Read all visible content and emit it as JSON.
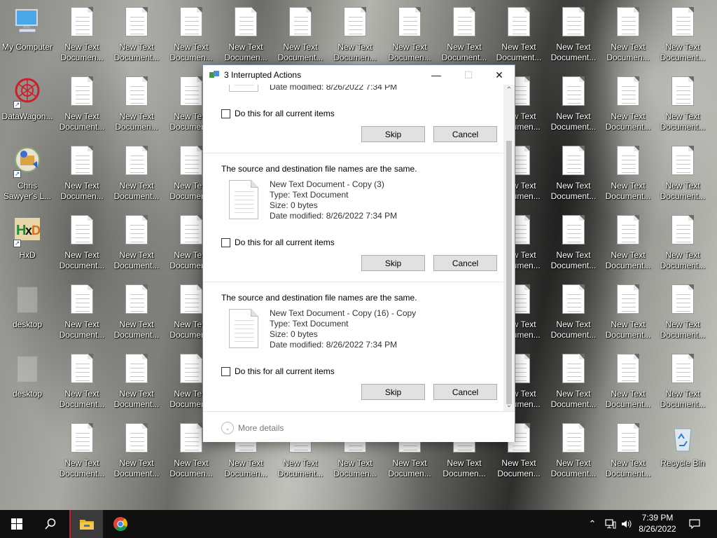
{
  "desktop": {
    "left_icons": [
      {
        "label": "My Computer",
        "icon": "monitor-icon"
      },
      {
        "label": "DataWagon...",
        "icon": "datawagon-icon"
      },
      {
        "label": "Chris\nSawyer's L...",
        "icon": "game-icon"
      },
      {
        "label": "HxD",
        "icon": "hxd-icon"
      },
      {
        "label": "desktop",
        "icon": "blank-file-icon"
      },
      {
        "label": "desktop",
        "icon": "blank-file-icon"
      }
    ],
    "file_labels": {
      "a": "New Text\nDocumen...",
      "b": "New Text\nDocument..."
    },
    "recycle_bin": "Recycle Bin"
  },
  "dialog": {
    "title": "3 Interrupted Actions",
    "controls": {
      "minimize": "—",
      "maximize": "☐",
      "close": "✕"
    },
    "partial_item": {
      "date": "Date modified: 8/26/2022 7:34 PM"
    },
    "items": [
      {
        "message": "The source and destination file names are the same.",
        "name": "New Text Document - Copy (3)",
        "type": "Type: Text Document",
        "size": "Size: 0 bytes",
        "date": "Date modified: 8/26/2022 7:34 PM"
      },
      {
        "message": "The source and destination file names are the same.",
        "name": "New Text Document - Copy (16) - Copy",
        "type": "Type: Text Document",
        "size": "Size: 0 bytes",
        "date": "Date modified: 8/26/2022 7:34 PM"
      }
    ],
    "checkbox_label": "Do this for all current items",
    "skip_label": "Skip",
    "cancel_label": "Cancel",
    "more_details": "More details"
  },
  "taskbar": {
    "time": "7:39 PM",
    "date": "8/26/2022"
  }
}
